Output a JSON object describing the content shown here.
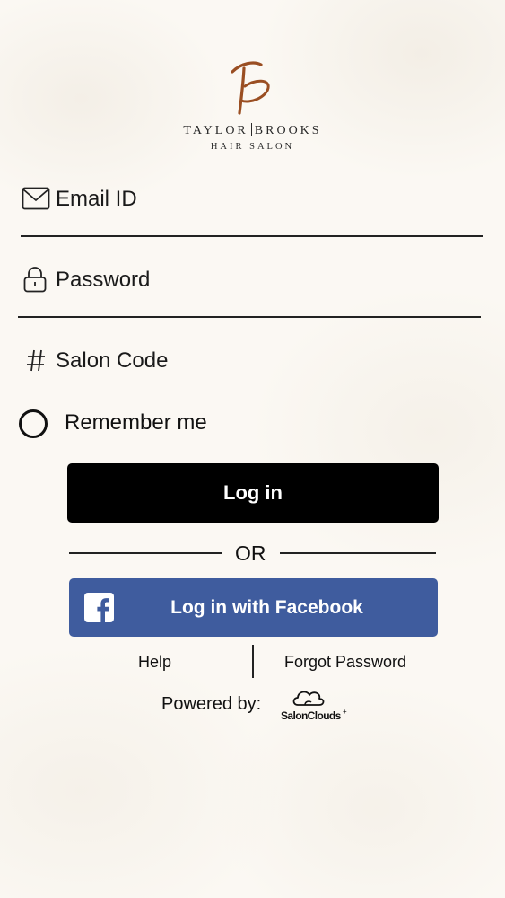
{
  "brand": {
    "name_left": "TAYLOR",
    "name_right": "BROOKS",
    "subtitle": "HAIR SALON",
    "accent_color": "#9a4e22"
  },
  "form": {
    "email": {
      "placeholder": "Email ID",
      "icon": "envelope-icon"
    },
    "password": {
      "placeholder": "Password",
      "icon": "lock-icon"
    },
    "salon_code": {
      "placeholder": "Salon Code",
      "icon": "hash-icon"
    },
    "remember_label": "Remember me",
    "remember_checked": false
  },
  "buttons": {
    "login_label": "Log in",
    "or_label": "OR",
    "facebook_label": "Log in with Facebook",
    "facebook_color": "#3f5c9e"
  },
  "links": {
    "help": "Help",
    "forgot": "Forgot Password"
  },
  "footer": {
    "powered_label": "Powered by:",
    "vendor": "SalonClouds",
    "vendor_suffix": "+"
  }
}
